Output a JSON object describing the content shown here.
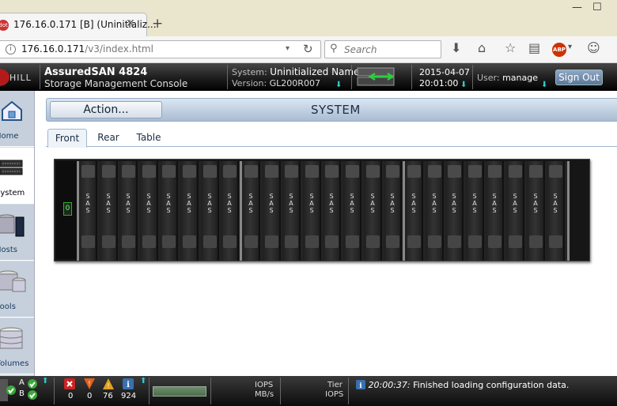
{
  "browser": {
    "tab_title": "176.16.0.171 [B] (Uninitializ...",
    "tab_favicon": "dot",
    "url_host": "176.16.0.171",
    "url_path": "/v3/index.html",
    "search_placeholder": "Search",
    "abp_label": "ABP"
  },
  "header": {
    "logo_text": "HILL",
    "product": "AssuredSAN 4824",
    "subtitle": "Storage Management Console",
    "system_label": "System:",
    "system_name": "Uninitialized Name",
    "version_label": "Version:",
    "version": "GL200R007",
    "date": "2015-04-07",
    "time": "20:01:00",
    "user_label": "User:",
    "user": "manage",
    "signout": "Sign Out"
  },
  "sidebar": {
    "items": [
      {
        "label": "Home",
        "icon": "home-icon",
        "active": false
      },
      {
        "label": "System",
        "icon": "system-icon",
        "active": true
      },
      {
        "label": "Hosts",
        "icon": "hosts-icon",
        "active": false
      },
      {
        "label": "Pools",
        "icon": "pools-icon",
        "active": false
      },
      {
        "label": "Volumes",
        "icon": "volumes-icon",
        "active": false
      }
    ]
  },
  "main": {
    "action_label": "Action...",
    "page_title": "SYSTEM",
    "tabs": [
      "Front",
      "Rear",
      "Table"
    ],
    "active_tab": "Front"
  },
  "enclosure": {
    "led": "0",
    "drive_label": "SAS",
    "banks": [
      8,
      8,
      8
    ]
  },
  "status": {
    "controller_a": "A",
    "controller_b": "B",
    "critical_count": "0",
    "error_count": "0",
    "warning_count": "76",
    "info_count": "924",
    "perf_iops": "IOPS",
    "perf_mbs": "MB/s",
    "tier_label": "Tier",
    "tier_iops": "IOPS",
    "msg_time": "20:00:37:",
    "msg_text": "Finished loading configuration data.",
    "colors": {
      "ok": "#3aa83a",
      "critical": "#cc2222",
      "warning": "#e0a020",
      "info": "#3a6fb0"
    }
  }
}
